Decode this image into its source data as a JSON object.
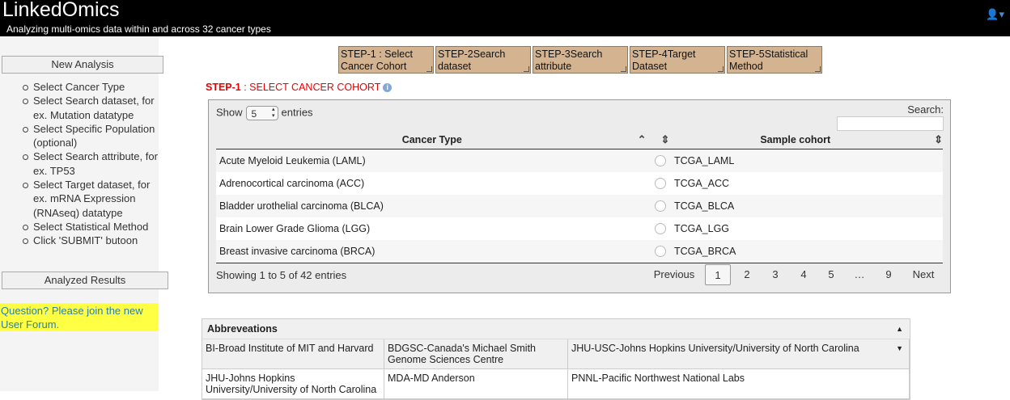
{
  "header": {
    "title": "LinkedOmics",
    "subtitle": "Analyzing multi-omics data within and across 32 cancer types",
    "user_icon": "user-icon"
  },
  "sidebar": {
    "new_analysis": "New Analysis",
    "steps": [
      "Select Cancer Type",
      "Select Search dataset, for ex. Mutation datatype",
      "Select Specific Population (optional)",
      "Select Search attribute, for ex. TP53",
      "Select Target dataset, for ex. mRNA Expression (RNAseq) datatype",
      "Select Statistical Method",
      "Click 'SUBMIT' butoon"
    ],
    "analyzed_results": "Analyzed Results",
    "forum": "Question? Please join the new User Forum."
  },
  "tabs": [
    "STEP-1 : Select Cancer Cohort",
    "STEP-2Search dataset",
    "STEP-3Search attribute",
    "STEP-4Target Dataset",
    "STEP-5Statistical Method"
  ],
  "step1": {
    "prefix": "STEP-1",
    "label": " : SELECT CANCER COHORT"
  },
  "table": {
    "show_label": "Show",
    "entries_value": "5",
    "entries_label": "entries",
    "search_label": "Search:",
    "columns": [
      "Cancer Type",
      "Sample cohort"
    ],
    "rows": [
      {
        "cancer": "Acute Myeloid Leukemia (LAML)",
        "cohort": "TCGA_LAML"
      },
      {
        "cancer": "Adrenocortical carcinoma (ACC)",
        "cohort": "TCGA_ACC"
      },
      {
        "cancer": "Bladder urothelial carcinoma (BLCA)",
        "cohort": "TCGA_BLCA"
      },
      {
        "cancer": "Brain Lower Grade Glioma (LGG)",
        "cohort": "TCGA_LGG"
      },
      {
        "cancer": "Breast invasive carcinoma (BRCA)",
        "cohort": "TCGA_BRCA"
      }
    ],
    "info": "Showing 1 to 5 of 42 entries",
    "pager": {
      "previous": "Previous",
      "pages": [
        "1",
        "2",
        "3",
        "4",
        "5",
        "…",
        "9"
      ],
      "next": "Next",
      "current": "1"
    }
  },
  "abbrev": {
    "title": "Abbreveations",
    "rows": [
      [
        "BI-Broad Institute of MIT and Harvard",
        "BDGSC-Canada's Michael Smith Genome Sciences Centre",
        "JHU-USC-Johns Hopkins University/University of North Carolina"
      ],
      [
        "JHU-Johns Hopkins University/University of North Carolina",
        "MDA-MD Anderson",
        "PNNL-Pacific Northwest National Labs"
      ]
    ]
  }
}
